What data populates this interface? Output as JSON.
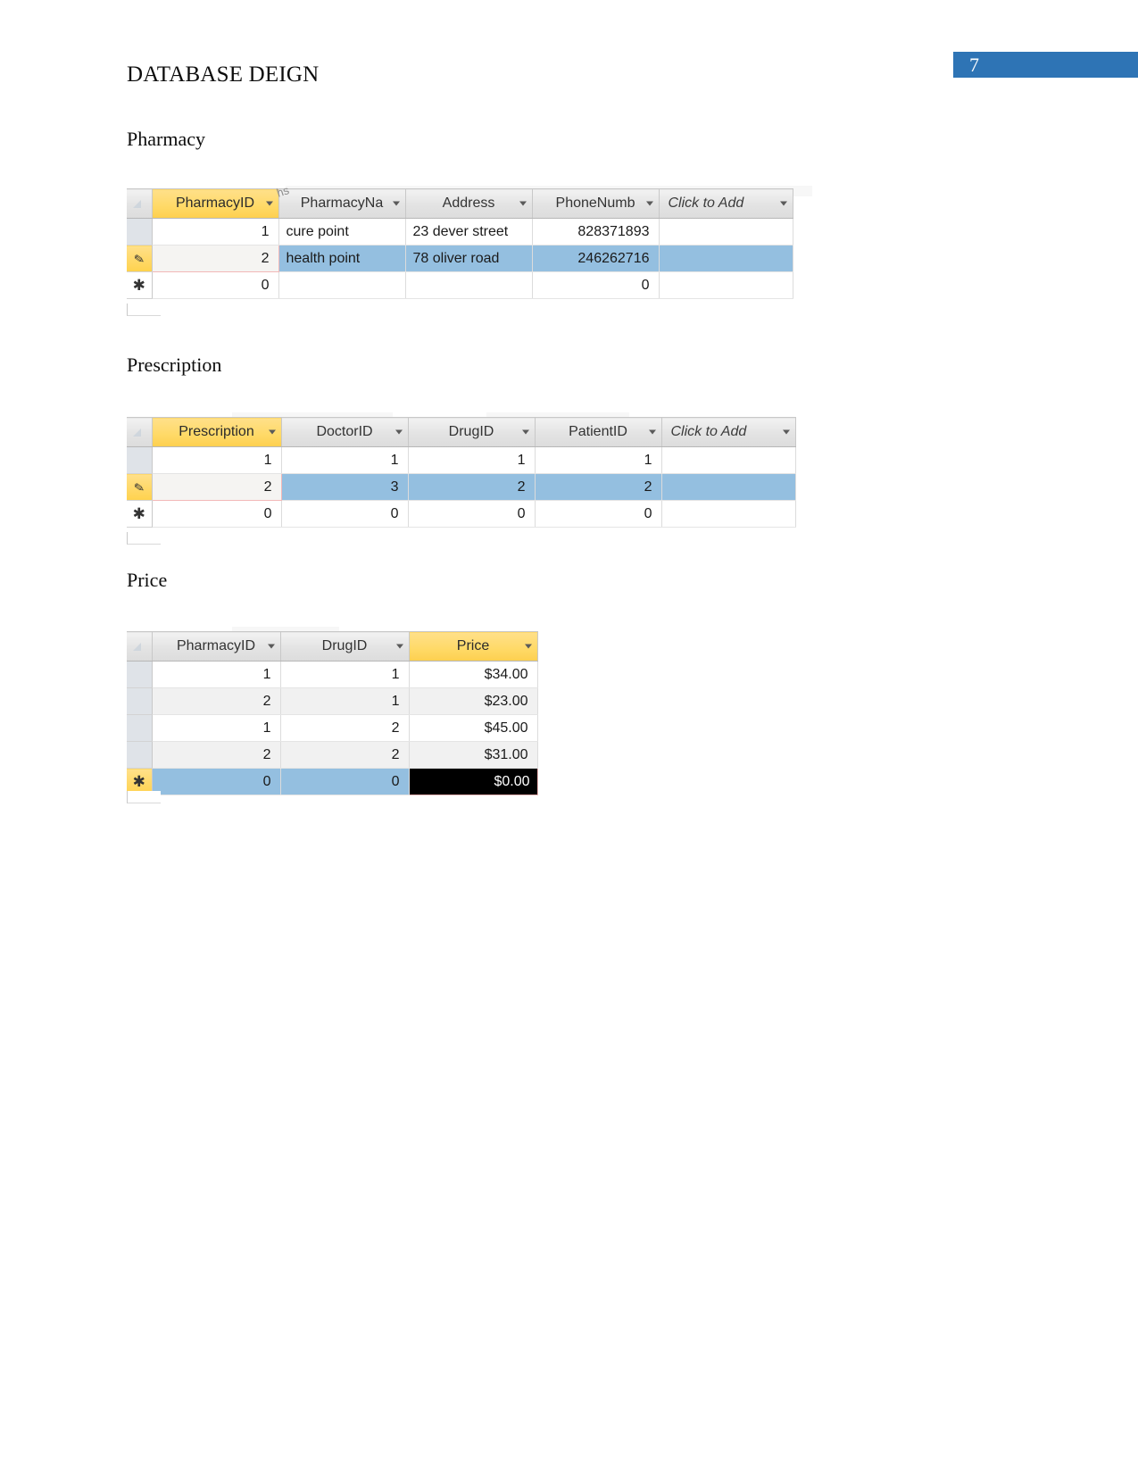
{
  "document": {
    "header_title": "DATABASE DEIGN",
    "page_number": "7"
  },
  "sections": [
    {
      "caption": "Pharmacy"
    },
    {
      "caption": "Prescription"
    },
    {
      "caption": "Price"
    }
  ],
  "tables": {
    "pharmacy": {
      "caption": "Pharmacy",
      "columns": [
        "PharmacyID",
        "PharmacyNa",
        "Address",
        "PhoneNumb",
        "Click to Add"
      ],
      "selected_column": "PharmacyID",
      "rows": [
        {
          "PharmacyID": "1",
          "PharmacyName": "cure point",
          "Address": "23 dever street",
          "PhoneNumber": "828371893",
          "ClickToAdd": ""
        },
        {
          "PharmacyID": "2",
          "PharmacyName": "health point",
          "Address": "78 oliver road",
          "PhoneNumber": "246262716",
          "ClickToAdd": ""
        },
        {
          "PharmacyID": "0",
          "PharmacyName": "",
          "Address": "",
          "PhoneNumber": "0",
          "ClickToAdd": ""
        }
      ],
      "row_selector_icons": [
        "",
        "pencil-icon",
        "asterisk-icon"
      ]
    },
    "prescription": {
      "caption": "Prescription",
      "columns": [
        "Prescription",
        "DoctorID",
        "DrugID",
        "PatientID",
        "Click to Add"
      ],
      "selected_column": "Prescription",
      "rows": [
        {
          "Prescription": "1",
          "DoctorID": "1",
          "DrugID": "1",
          "PatientID": "1",
          "ClickToAdd": ""
        },
        {
          "Prescription": "2",
          "DoctorID": "3",
          "DrugID": "2",
          "PatientID": "2",
          "ClickToAdd": ""
        },
        {
          "Prescription": "0",
          "DoctorID": "0",
          "DrugID": "0",
          "PatientID": "0",
          "ClickToAdd": ""
        }
      ],
      "row_selector_icons": [
        "",
        "pencil-icon",
        "asterisk-icon"
      ]
    },
    "price": {
      "caption": "Price",
      "columns": [
        "PharmacyID",
        "DrugID",
        "Price"
      ],
      "selected_column": "Price",
      "rows": [
        {
          "PharmacyID": "1",
          "DrugID": "1",
          "Price": "$34.00"
        },
        {
          "PharmacyID": "2",
          "DrugID": "1",
          "Price": "$23.00"
        },
        {
          "PharmacyID": "1",
          "DrugID": "2",
          "Price": "$45.00"
        },
        {
          "PharmacyID": "2",
          "DrugID": "2",
          "Price": "$31.00"
        },
        {
          "PharmacyID": "0",
          "DrugID": "0",
          "Price": "$0.00"
        }
      ],
      "row_selector_icons": [
        "",
        "",
        "",
        "",
        "asterisk-icon"
      ]
    }
  },
  "colors": {
    "banner_blue": "#2e74b5",
    "selected_header_yellow": "#ffd966",
    "selected_row_blue": "#94bfe0",
    "active_cell_border_pink": "#f2b8b8",
    "inverse_cell_black": "#000000"
  },
  "artifacts": {
    "cursor_text": "hs"
  }
}
